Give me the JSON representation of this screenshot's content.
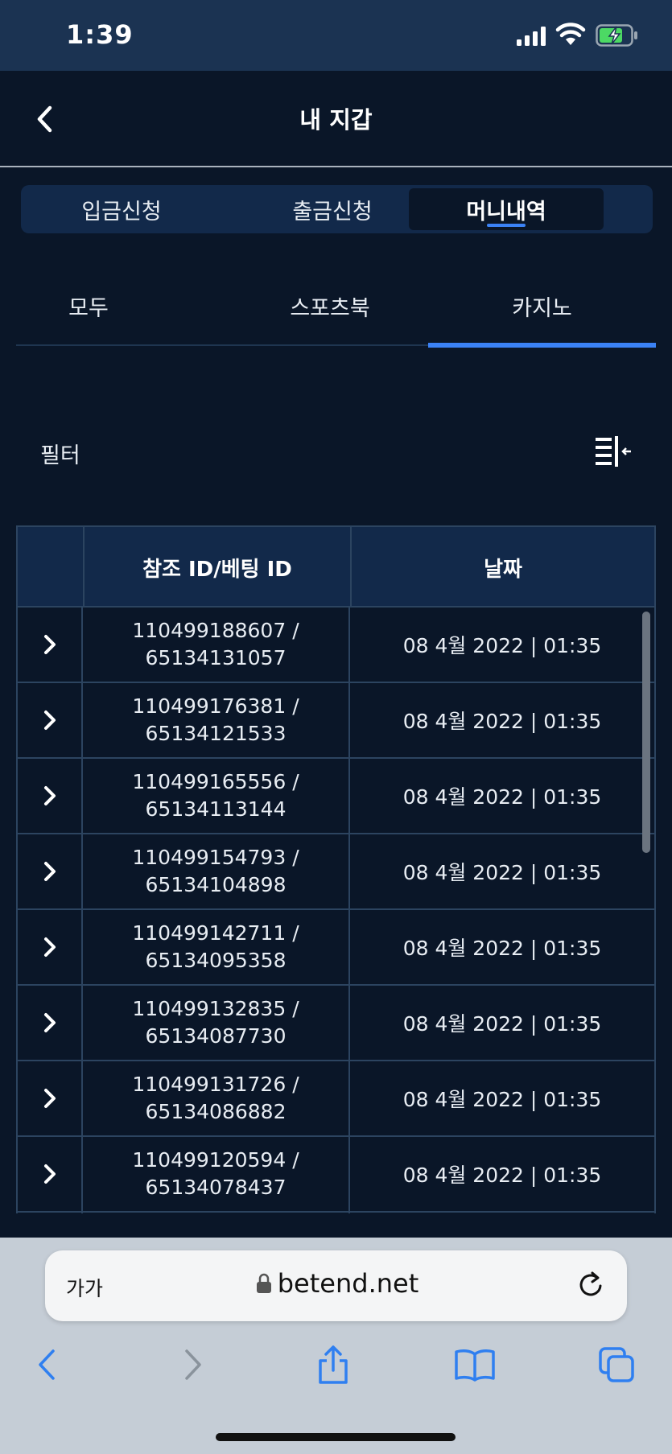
{
  "status": {
    "time": "1:39"
  },
  "header": {
    "title": "내 지갑"
  },
  "segments": [
    {
      "label": "입금신청"
    },
    {
      "label": "출금신청"
    },
    {
      "label": "머니내역"
    }
  ],
  "subtabs": [
    {
      "label": "모두"
    },
    {
      "label": "스포츠북"
    },
    {
      "label": "카지노"
    }
  ],
  "filter": {
    "label": "필터"
  },
  "table": {
    "headers": {
      "id": "참조 ID/베팅 ID",
      "date": "날짜"
    },
    "rows": [
      {
        "ref_id": "110499188607 /",
        "bet_id": "65134131057",
        "date": "08 4월 2022 | 01:35"
      },
      {
        "ref_id": "110499176381 /",
        "bet_id": "65134121533",
        "date": "08 4월 2022 | 01:35"
      },
      {
        "ref_id": "110499165556 /",
        "bet_id": "65134113144",
        "date": "08 4월 2022 | 01:35"
      },
      {
        "ref_id": "110499154793 /",
        "bet_id": "65134104898",
        "date": "08 4월 2022 | 01:35"
      },
      {
        "ref_id": "110499142711 /",
        "bet_id": "65134095358",
        "date": "08 4월 2022 | 01:35"
      },
      {
        "ref_id": "110499132835 /",
        "bet_id": "65134087730",
        "date": "08 4월 2022 | 01:35"
      },
      {
        "ref_id": "110499131726 /",
        "bet_id": "65134086882",
        "date": "08 4월 2022 | 01:35"
      },
      {
        "ref_id": "110499120594 /",
        "bet_id": "65134078437",
        "date": "08 4월 2022 | 01:35"
      }
    ]
  },
  "browser": {
    "text_size_label": "가가",
    "url": "betend.net"
  },
  "colors": {
    "background": "#0a1628",
    "header_row": "#12294a",
    "accent": "#3b82f6",
    "battery": "#4cd964"
  }
}
